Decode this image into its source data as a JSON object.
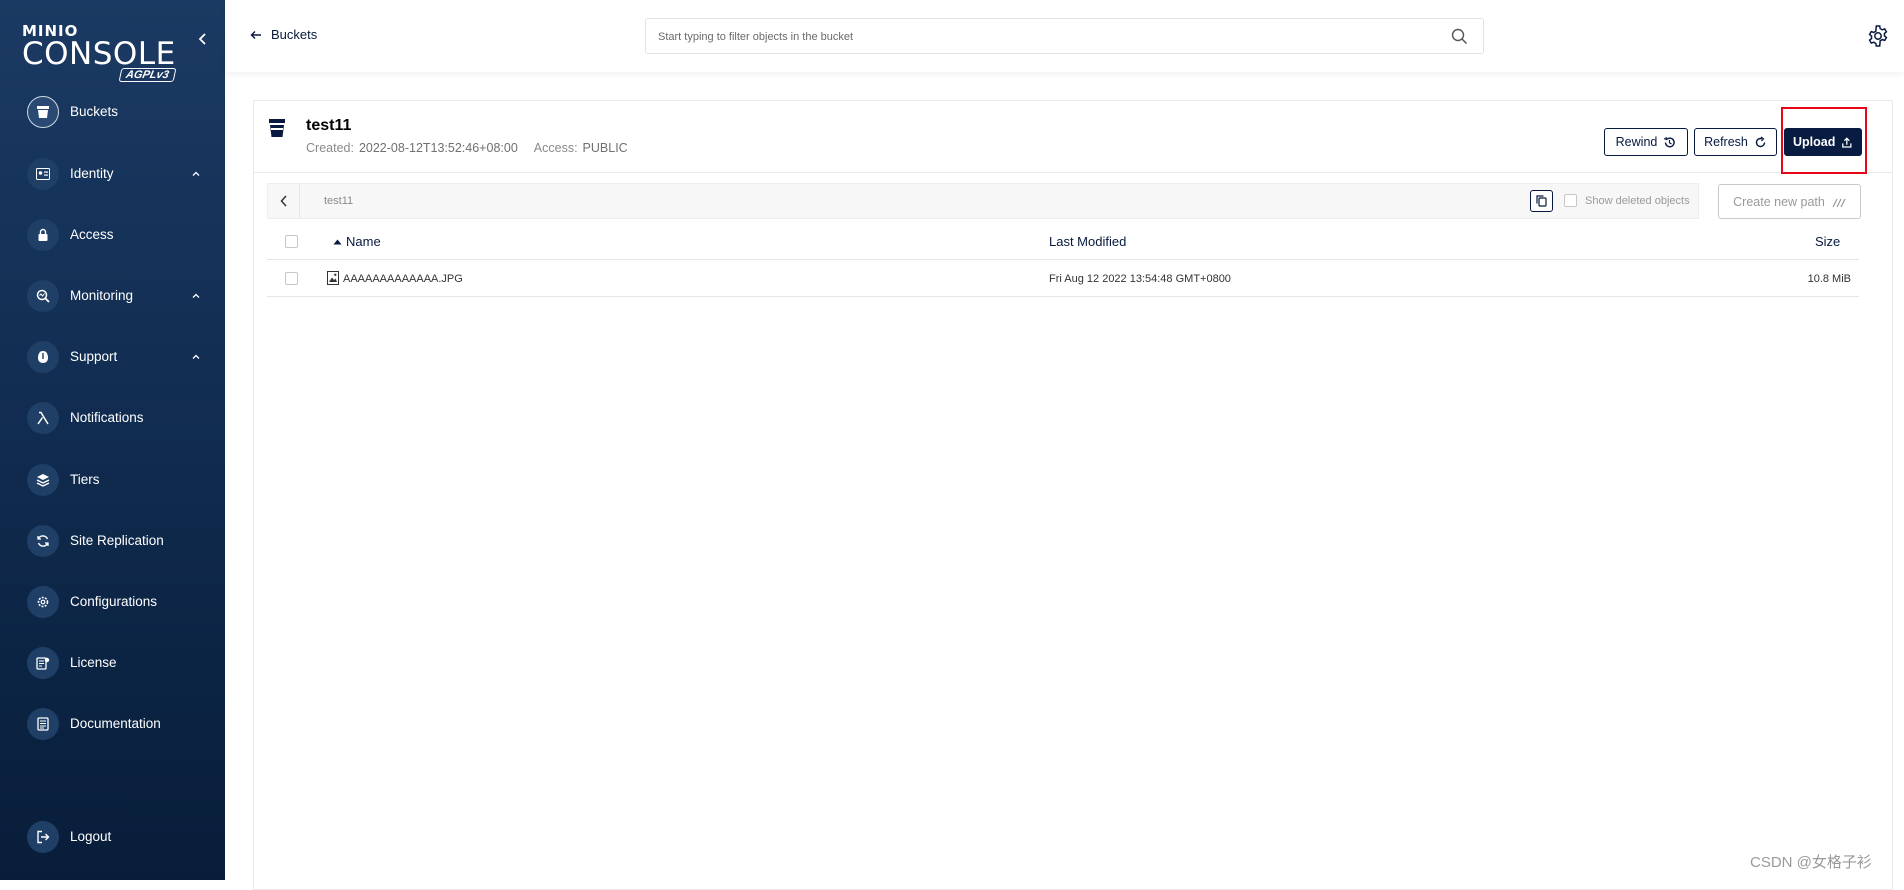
{
  "sidebar": {
    "logo": {
      "brand": "MINIO",
      "product": "CONSOLE",
      "license": "AGPLv3"
    },
    "items": [
      {
        "label": "Buckets",
        "icon": "bucket-icon",
        "active": true,
        "expandable": false
      },
      {
        "label": "Identity",
        "icon": "identity-icon",
        "active": false,
        "expandable": true
      },
      {
        "label": "Access",
        "icon": "access-icon",
        "active": false,
        "expandable": false
      },
      {
        "label": "Monitoring",
        "icon": "monitoring-icon",
        "active": false,
        "expandable": true
      },
      {
        "label": "Support",
        "icon": "support-icon",
        "active": false,
        "expandable": true
      },
      {
        "label": "Notifications",
        "icon": "lambda-icon",
        "active": false,
        "expandable": false
      },
      {
        "label": "Tiers",
        "icon": "tiers-icon",
        "active": false,
        "expandable": false
      },
      {
        "label": "Site Replication",
        "icon": "replication-icon",
        "active": false,
        "expandable": false
      },
      {
        "label": "Configurations",
        "icon": "gear-icon",
        "active": false,
        "expandable": false
      },
      {
        "label": "License",
        "icon": "license-icon",
        "active": false,
        "expandable": false
      },
      {
        "label": "Documentation",
        "icon": "documentation-icon",
        "active": false,
        "expandable": false
      }
    ],
    "logout": {
      "label": "Logout",
      "icon": "logout-icon"
    }
  },
  "header": {
    "back_label": "Buckets",
    "search_placeholder": "Start typing to filter objects in the bucket"
  },
  "bucket": {
    "name": "test11",
    "created_label": "Created:",
    "created_value": "2022-08-12T13:52:46+08:00",
    "access_label": "Access:",
    "access_value": "PUBLIC"
  },
  "toolbar": {
    "rewind_label": "Rewind",
    "refresh_label": "Refresh",
    "upload_label": "Upload",
    "upload_highlighted": true
  },
  "browser": {
    "path": "test11",
    "show_deleted_label": "Show deleted objects",
    "show_deleted_checked": false,
    "create_path_label": "Create new path"
  },
  "table": {
    "columns": {
      "name": "Name",
      "modified": "Last Modified",
      "size": "Size"
    },
    "sort": {
      "column": "name",
      "direction": "ascending"
    },
    "rows": [
      {
        "name": "AAAAAAAAAAAAA.JPG",
        "modified": "Fri Aug 12 2022 13:54:48 GMT+0800",
        "size": "10.8 MiB",
        "icon": "image-file-icon",
        "checked": false
      }
    ]
  },
  "watermark": "CSDN @女格子衫",
  "colors": {
    "sidebar": "#0f2a4d",
    "accent": "#081c42",
    "highlight": "#e8061b"
  }
}
